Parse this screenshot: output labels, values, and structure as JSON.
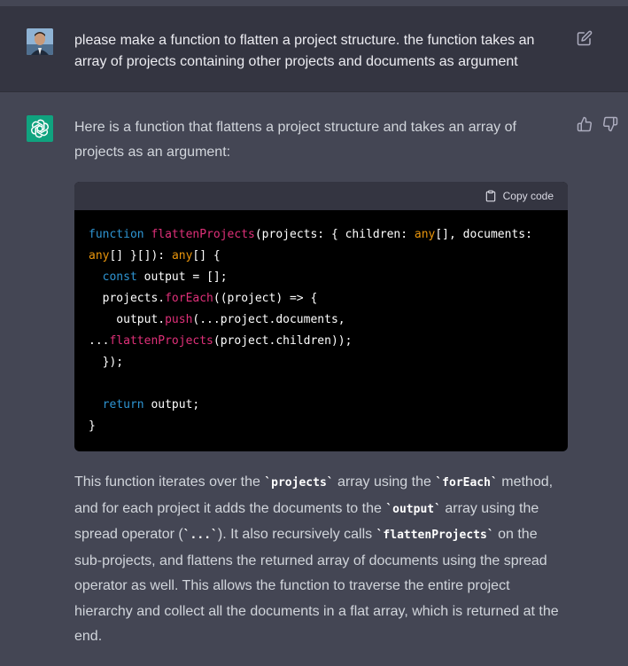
{
  "user_message": {
    "text": "please make a function to flatten a project structure. the function takes an array of projects containing other projects and documents as argument"
  },
  "assistant_message": {
    "intro": "Here is a function that flattens a project structure and takes an array of projects as an argument:",
    "copy_label": "Copy code",
    "code": {
      "kw_function": "function",
      "fn_name": "flattenProjects",
      "sig_a": "(projects: { children: ",
      "ty_any": "any",
      "sig_b": "[], documents:",
      "sig_c": "[] }[]): ",
      "sig_d": "[] {",
      "kw_const": "const",
      "l3_rest": " output = [];",
      "l4_a": "  projects.",
      "fn_forEach": "forEach",
      "l4_b": "((project) => {",
      "l5_a": "    output.",
      "fn_push": "push",
      "l5_b": "(...project.documents,",
      "l6_a": "...",
      "l6_b": "(project.children));",
      "l7": "  });",
      "kw_return": "return",
      "l9_rest": " output;",
      "l10": "}"
    },
    "explanation": {
      "t1": "This function iterates over the ",
      "c1": "`projects`",
      "t2": " array using the ",
      "c2": "`forEach`",
      "t3": " method, and for each project it adds the documents to the ",
      "c3": "`output`",
      "t4": " array using the spread operator (",
      "c4": "`...`",
      "t5": "). It also recursively calls ",
      "c5": "`flattenProjects`",
      "t6": " on the sub-projects, and flattens the returned array of documents using the spread operator as well. This allows the function to traverse the entire project hierarchy and collect all the documents in a flat array, which is returned at the end."
    }
  },
  "colors": {
    "user_bg": "#343541",
    "assistant_bg": "#444654",
    "gpt_brand": "#10a37f",
    "code_bg": "#000000",
    "keyword": "#2e95d3",
    "function": "#df3079",
    "type": "#e9950c"
  }
}
